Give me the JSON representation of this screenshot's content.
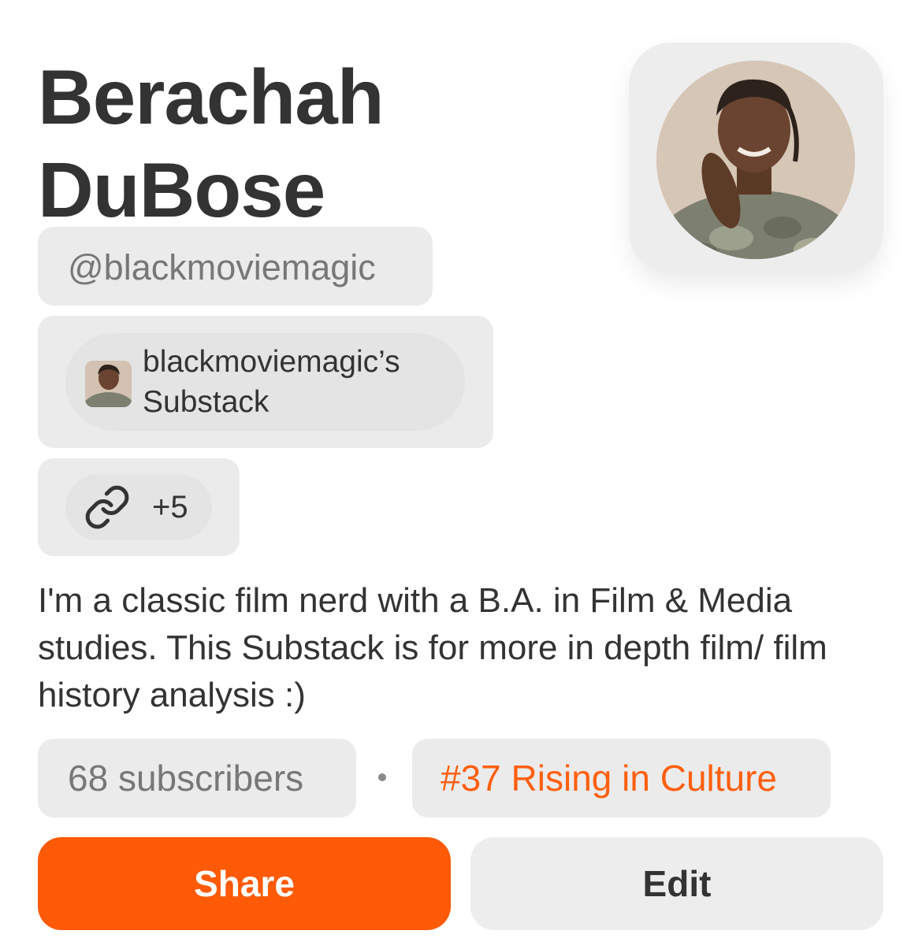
{
  "profile": {
    "name": "Berachah DuBose",
    "handle": "@blackmoviemagic",
    "avatar_icon": "profile-photo",
    "publication": {
      "name": "blackmoviemagic’s Substack",
      "icon": "publication-logo"
    },
    "links": {
      "icon": "link-icon",
      "count_label": "+5"
    },
    "bio": "I'm a classic film nerd with a B.A. in Film & Media studies. This Substack is for more in depth film/ film history analysis :)",
    "stats": {
      "subscribers_label": "68 subscribers",
      "separator": "·",
      "ranking_label": "#37 Rising in Culture"
    }
  },
  "actions": {
    "share_label": "Share",
    "edit_label": "Edit"
  },
  "colors": {
    "accent": "#ff5a07",
    "ranking_text": "#ff5f0f",
    "chip_background": "#ebebeb",
    "primary_text": "#333333",
    "secondary_text": "#777777"
  }
}
